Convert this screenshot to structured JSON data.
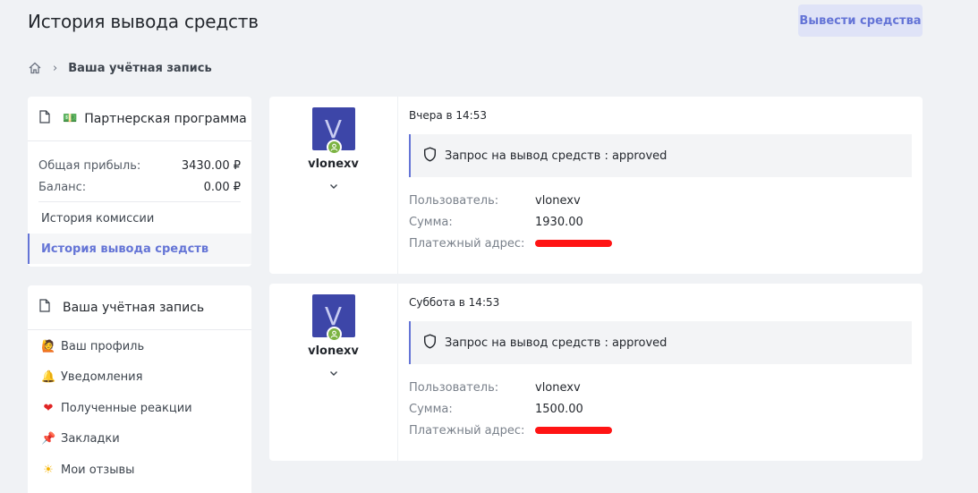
{
  "header": {
    "title": "История вывода средств",
    "withdraw_button": "Вывести средства"
  },
  "breadcrumb": {
    "current": "Ваша учётная запись"
  },
  "affiliate": {
    "title": "Партнерская программа",
    "stats": [
      {
        "label": "Общая прибыль:",
        "value": "3430.00 ₽"
      },
      {
        "label": "Баланс:",
        "value": "0.00 ₽"
      }
    ],
    "links": [
      {
        "label": "История комиссии",
        "active": false
      },
      {
        "label": "История вывода средств",
        "active": true
      }
    ]
  },
  "account": {
    "title": "Ваша учётная запись",
    "items": [
      {
        "icon": "person-icon",
        "label": "Ваш профиль"
      },
      {
        "icon": "bell-icon",
        "label": "Уведомления"
      },
      {
        "icon": "heart-icon",
        "label": "Полученные реакции"
      },
      {
        "icon": "pin-icon",
        "label": "Закладки"
      },
      {
        "icon": "sun-icon",
        "label": "Мои отзывы"
      }
    ]
  },
  "entries": [
    {
      "avatar_letter": "V",
      "username": "vlonexv",
      "date": "Вчера в 14:53",
      "status": "Запрос на вывод средств : approved",
      "user_label": "Пользователь:",
      "user_value": "vlonexv",
      "amount_label": "Сумма:",
      "amount_value": "1930.00",
      "address_label": "Платежный адрес:"
    },
    {
      "avatar_letter": "V",
      "username": "vlonexv",
      "date": "Суббота в 14:53",
      "status": "Запрос на вывод средств : approved",
      "user_label": "Пользователь:",
      "user_value": "vlonexv",
      "amount_label": "Сумма:",
      "amount_value": "1500.00",
      "address_label": "Платежный адрес:"
    }
  ],
  "colors": {
    "accent": "#6474d6",
    "avatar_bg": "#3d46a8",
    "redaction": "#ff1414"
  }
}
